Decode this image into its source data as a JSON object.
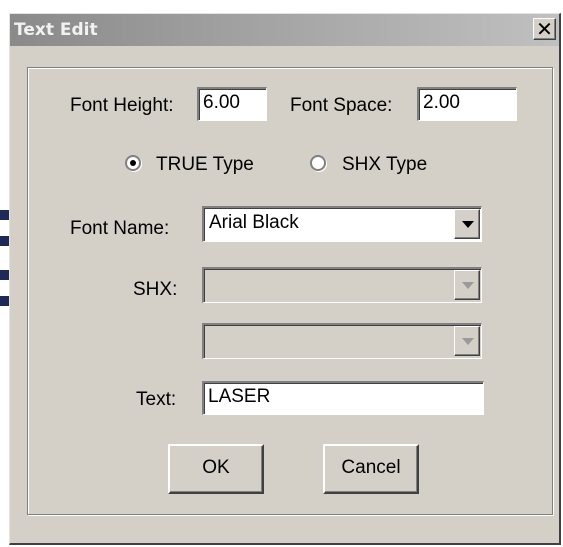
{
  "window": {
    "title": "Text Edit",
    "close_label": "X"
  },
  "font_height": {
    "label": "Font Height:",
    "value": "6.00"
  },
  "font_space": {
    "label": "Font Space:",
    "value": "2.00"
  },
  "type_options": [
    {
      "label": "TRUE Type",
      "selected": true
    },
    {
      "label": "SHX Type",
      "selected": false
    }
  ],
  "font_name": {
    "label": "Font Name:",
    "value": "Arial Black"
  },
  "shx": {
    "label": "SHX:",
    "value": "",
    "value2": ""
  },
  "text": {
    "label": "Text:",
    "value": "LASER"
  },
  "buttons": {
    "ok": "OK",
    "cancel": "Cancel"
  }
}
